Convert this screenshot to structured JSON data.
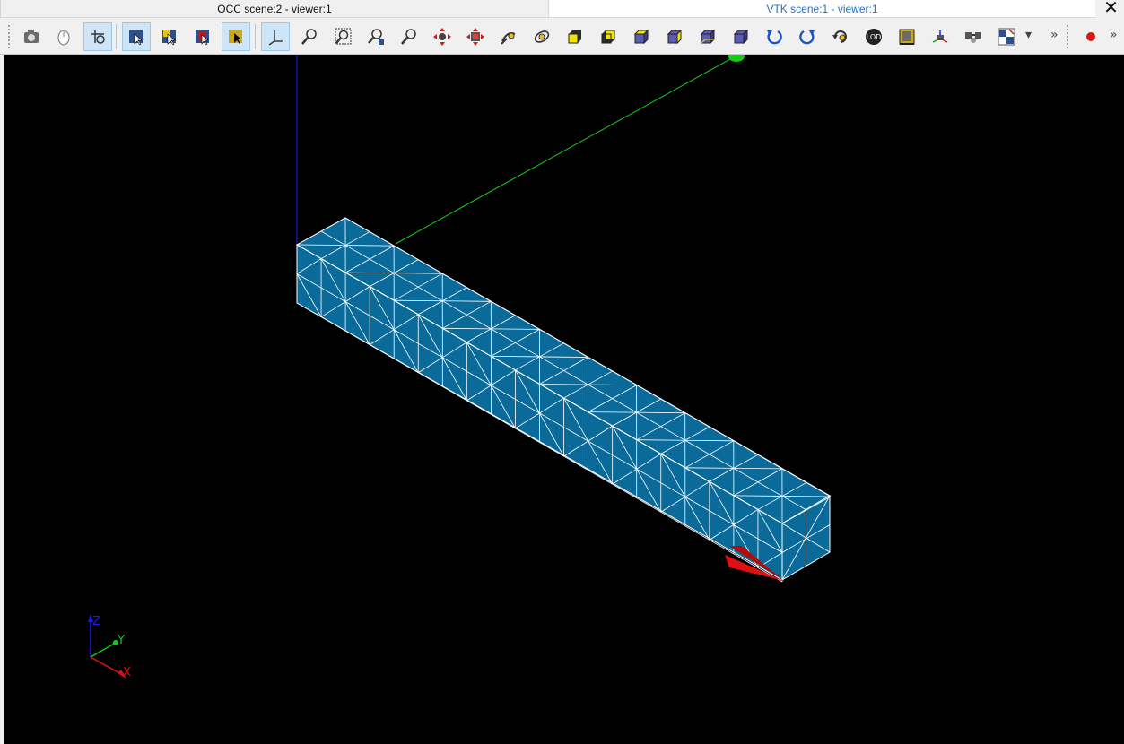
{
  "tabs": [
    {
      "label": "OCC scene:2 - viewer:1",
      "active": false
    },
    {
      "label": "VTK scene:1 - viewer:1",
      "active": true
    }
  ],
  "close_glyph": "✕",
  "toolbar": {
    "buttons": [
      "dump-view-icon",
      "interaction-style-icon",
      "zoom-style-icon",
      "rectangle-select-icon",
      "polygon-select-icon",
      "preselection-icon",
      "select-icon",
      "show-trihedron-icon",
      "fit-all-icon",
      "fit-area-icon",
      "fit-selection-icon",
      "zoom-icon",
      "pan-icon",
      "global-pan-icon",
      "change-rotation-point-icon",
      "rotate-icon",
      "view-front-icon",
      "view-back-icon",
      "view-top-icon",
      "view-bottom-icon",
      "view-left-icon",
      "view-right-icon",
      "rotate-counterclockwise-icon",
      "rotate-clockwise-icon",
      "reset-view-icon",
      "lod-icon",
      "graduated-axes-icon",
      "perspective-icon",
      "synchronize-icon",
      "split-view-icon",
      "record-icon"
    ],
    "overflow_glyph": "»",
    "lod_label": "LOD"
  },
  "triedron": {
    "x": "X",
    "y": "Y",
    "z": "Z"
  },
  "colors": {
    "mesh_fill": "#0a6b9a",
    "mesh_edge": "#ffffff",
    "axis_x": "#e01010",
    "axis_y": "#19c819",
    "axis_z": "#1a1aff",
    "background": "#000000"
  }
}
